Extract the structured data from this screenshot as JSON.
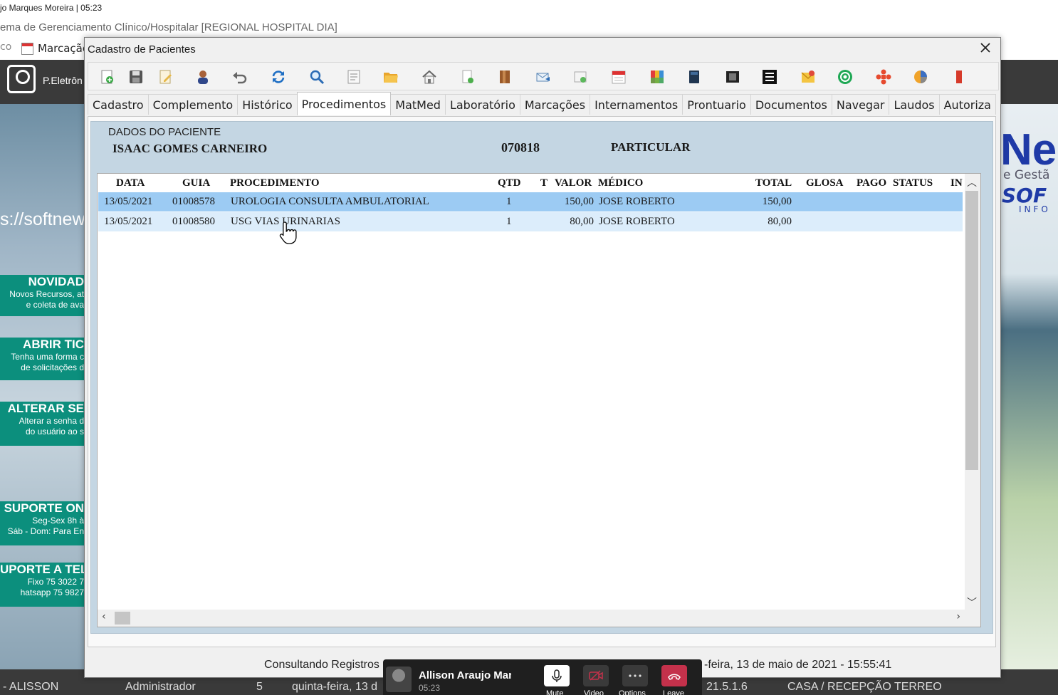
{
  "background": {
    "caption": "jo Marques Moreira | 05:23",
    "system_title": "ema de Gerenciamento Clínico/Hospitalar [REGIONAL HOSPITAL DIA]",
    "menu_prefix": "co",
    "menu_item": "Marcação",
    "user_label": "P.Eletrôn",
    "url_text": "s://softnew",
    "promos": [
      {
        "title": "NOVIDAD",
        "line1": "Novos Recursos, at",
        "line2": "e coleta de ava"
      },
      {
        "title": "ABRIR TIC",
        "line1": "Tenha uma forma c",
        "line2": "de solicitações d"
      },
      {
        "title": "ALTERAR SE",
        "line1": "Alterar a senha d",
        "line2": "do usuário ao s"
      },
      {
        "title": "SUPORTE ON",
        "line1": "Seg-Sex 8h à",
        "line2": "Sáb - Dom: Para En"
      },
      {
        "title": "UPORTE A TEL",
        "line1": "Fixo 75 3022 7",
        "line2": "hatsapp 75 9827"
      }
    ],
    "right_brand": {
      "big": "Ne",
      "gest": "e Gestã",
      "so": "SOF",
      "info": "INFO"
    },
    "statusbar": {
      "user": "- ALISSON",
      "role": "Administrador",
      "num": "5",
      "day": "quinta-feira, 13 d",
      "version": "21.5.1.6",
      "location": "CASA / RECEPÇÃO TERREO"
    }
  },
  "dialog": {
    "title": "Cadastro de Pacientes",
    "toolbar_icons": [
      "new-icon",
      "save-icon",
      "edit-icon",
      "user-icon",
      "undo-icon",
      "refresh-icon",
      "search-icon",
      "list-icon",
      "folder-icon",
      "home-icon",
      "document-add-icon",
      "book-icon",
      "email-icon",
      "card-icon",
      "calendar-icon",
      "chart-icon",
      "notebook-icon",
      "film-icon",
      "menu-list-icon",
      "envelope-icon",
      "whatsapp-icon",
      "medical-cross-icon",
      "pie-chart-icon",
      "exit-icon"
    ],
    "tabs": [
      "Cadastro",
      "Complemento",
      "Histórico",
      "Procedimentos",
      "MatMed",
      "Laboratório",
      "Marcações",
      "Internamentos",
      "Prontuario",
      "Documentos",
      "Navegar",
      "Laudos",
      "Autoriza"
    ],
    "active_tab": 3,
    "patient": {
      "section_label": "DADOS DO PACIENTE",
      "name": "ISAAC GOMES CARNEIRO",
      "code": "070818",
      "plan": "PARTICULAR"
    },
    "grid": {
      "columns": [
        "DATA",
        "GUIA",
        "PROCEDIMENTO",
        "QTD",
        "T",
        "VALOR",
        "MÉDICO",
        "TOTAL",
        "GLOSA",
        "PAGO",
        "STATUS",
        "IN"
      ],
      "rows": [
        {
          "data": "13/05/2021",
          "guia": "01008578",
          "procedimento": "UROLOGIA CONSULTA AMBULATORIAL",
          "qtd": "1",
          "t": "",
          "valor": "150,00",
          "medico": "JOSE ROBERTO",
          "total": "150,00",
          "glosa": "",
          "pago": "",
          "status": ""
        },
        {
          "data": "13/05/2021",
          "guia": "01008580",
          "procedimento": "USG VIAS URINARIAS",
          "qtd": "1",
          "t": "",
          "valor": "80,00",
          "medico": "JOSE ROBERTO",
          "total": "80,00",
          "glosa": "",
          "pago": "",
          "status": ""
        }
      ]
    },
    "status": {
      "left": "Consultando Registros",
      "right": "-feira, 13 de maio de 2021  -  15:55:41"
    }
  },
  "call": {
    "name": "Allison Araujo Marc",
    "time": "05:23",
    "mute_label": "Mute",
    "video_label": "Video",
    "options_label": "Options",
    "leave_label": "Leave"
  },
  "colors": {
    "selected_row": "#9ccbf3",
    "alt_row": "#dcedfb",
    "panel_bg": "#c4d6e3",
    "leave": "#c4314b",
    "promo": "#0c8f7d"
  }
}
